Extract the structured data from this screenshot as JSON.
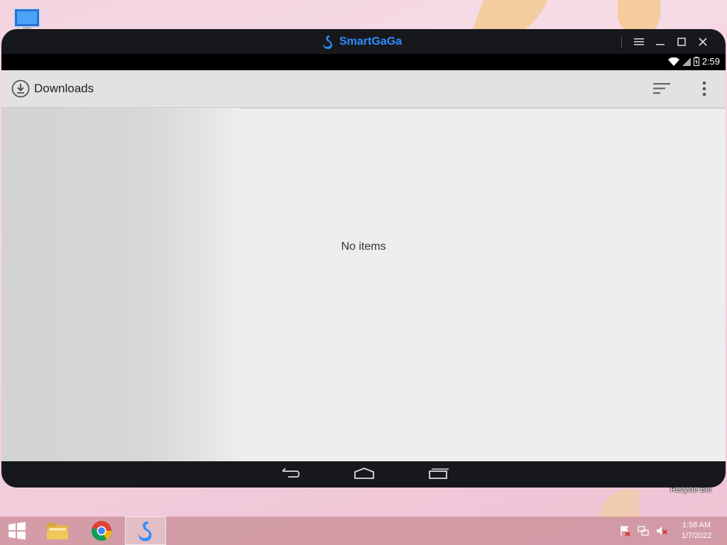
{
  "window": {
    "brand": "SmartGaGa",
    "controls": [
      "menu",
      "minimize",
      "maximize",
      "close"
    ]
  },
  "status": {
    "time": "2:59"
  },
  "app": {
    "title": "Downloads",
    "empty_message": "No items"
  },
  "desktop": {
    "recycle_bin_label": "Recycle Bin"
  },
  "taskbar": {
    "time": "1:58 AM",
    "date": "1/7/2022"
  },
  "colors": {
    "brand": "#2f8cff",
    "window_bg": "#17181c",
    "actionbar": "#e2e2e2"
  }
}
